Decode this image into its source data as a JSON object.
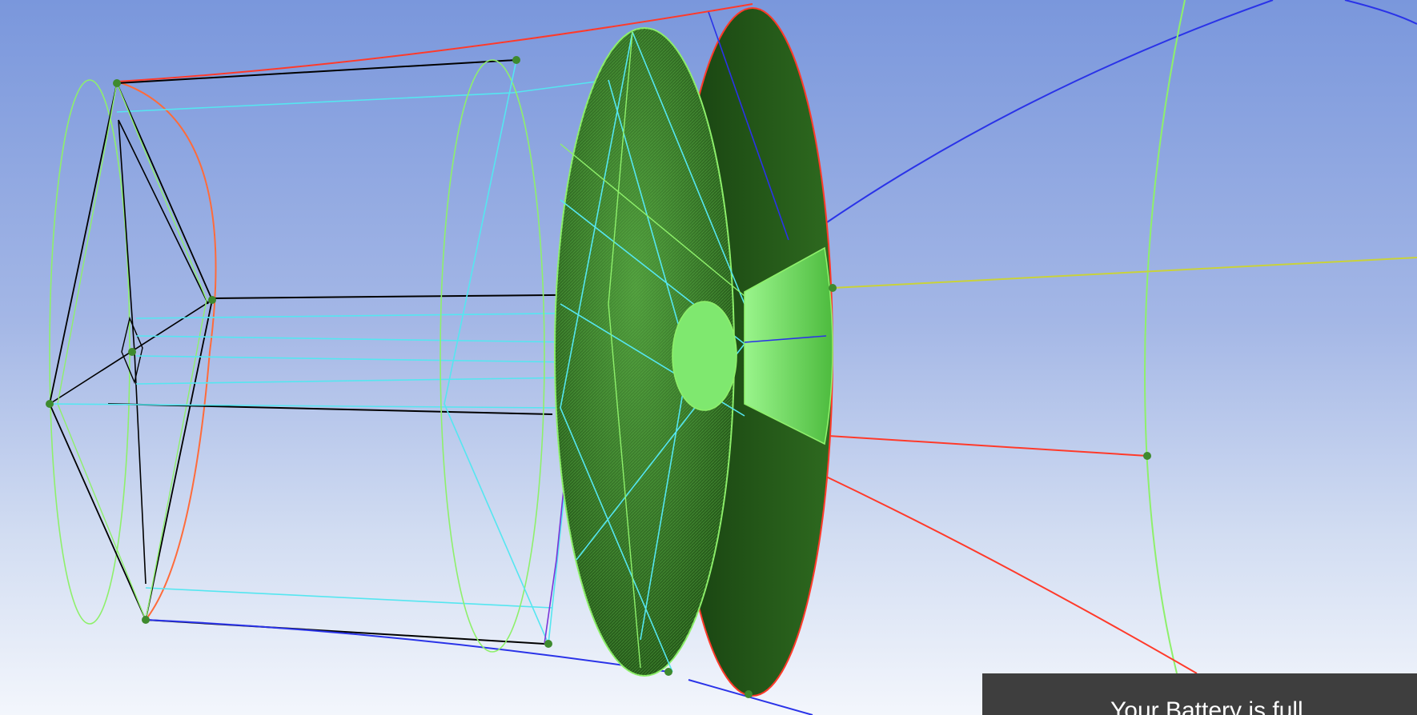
{
  "scene": {
    "background_top": "#7a97dc",
    "background_bottom": "#f3f6fc",
    "body_color": "#1d4a12",
    "face_color": "#2f6b22",
    "highlight_color": "#7fe86f",
    "edge_green": "#8ef06b",
    "edge_cyan": "#55e6f0",
    "edge_red": "#ff3a2a",
    "edge_blue": "#2a33e8",
    "edge_black": "#000000",
    "vertex_color": "#3e8a2e"
  },
  "notification": {
    "text": "Your Battery is full"
  }
}
